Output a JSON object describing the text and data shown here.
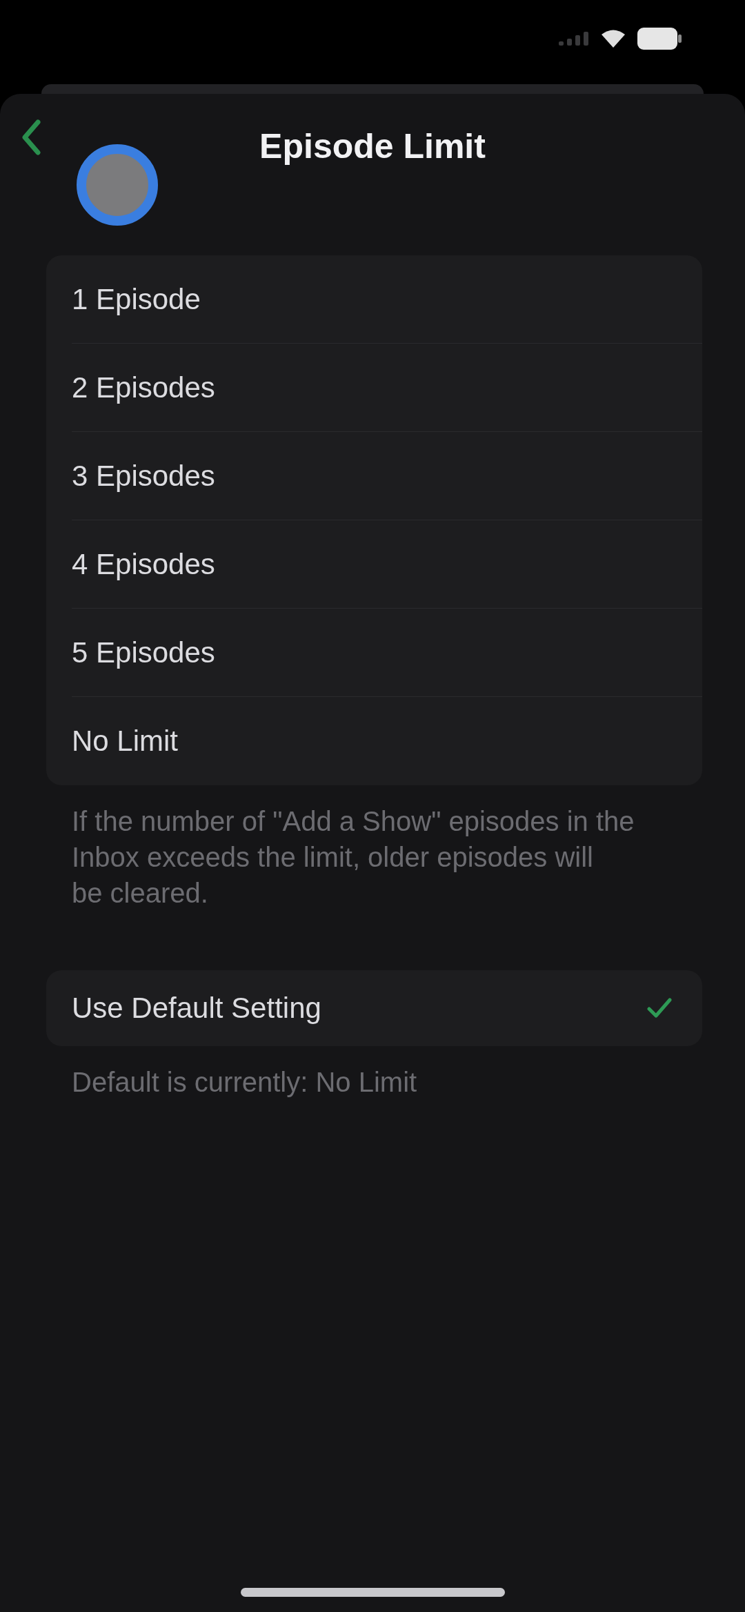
{
  "navigation": {
    "title": "Episode Limit"
  },
  "options": [
    {
      "label": "1 Episode",
      "selected": false
    },
    {
      "label": "2 Episodes",
      "selected": false
    },
    {
      "label": "3 Episodes",
      "selected": false
    },
    {
      "label": "4 Episodes",
      "selected": false
    },
    {
      "label": "5 Episodes",
      "selected": false
    },
    {
      "label": "No Limit",
      "selected": false
    }
  ],
  "limit_note": "If the number of \"Add a Show\" episodes in the Inbox exceeds the limit, older episodes will be cleared.",
  "default_setting": {
    "label": "Use Default Setting",
    "checked": true
  },
  "default_note": "Default is currently: No Limit"
}
